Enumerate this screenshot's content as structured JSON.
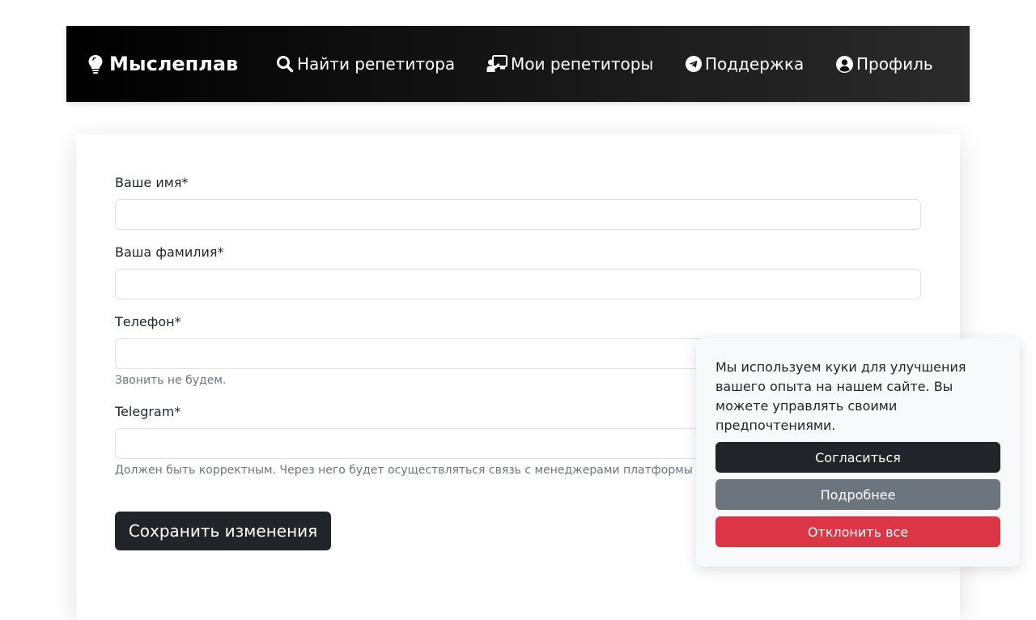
{
  "navbar": {
    "brand": "Мыслеплав",
    "links": [
      {
        "label": "Найти репетитора",
        "icon": "search-icon"
      },
      {
        "label": "Мои репетиторы",
        "icon": "teacher-icon"
      },
      {
        "label": "Поддержка",
        "icon": "telegram-icon"
      },
      {
        "label": "Профиль",
        "icon": "user-circle-icon"
      }
    ]
  },
  "form": {
    "first_name": {
      "label": "Ваше имя*",
      "value": ""
    },
    "last_name": {
      "label": "Ваша фамилия*",
      "value": ""
    },
    "phone": {
      "label": "Телефон*",
      "value": "",
      "help": "Звонить не будем."
    },
    "telegram": {
      "label": "Telegram*",
      "value": "",
      "help": "Должен быть корректным. Через него будет осуществляться связь с менеджерами платформы"
    },
    "save_label": "Сохранить изменения"
  },
  "cookie_banner": {
    "text": "Мы используем куки для улучшения вашего опыта на нашем сайте. Вы можете управлять своими предпочтениями.",
    "accept_label": "Согласиться",
    "details_label": "Подробнее",
    "decline_label": "Отклонить все"
  },
  "colors": {
    "dark": "#212529",
    "secondary": "#6c757d",
    "danger": "#dc3545",
    "light": "#f8f9fa"
  }
}
